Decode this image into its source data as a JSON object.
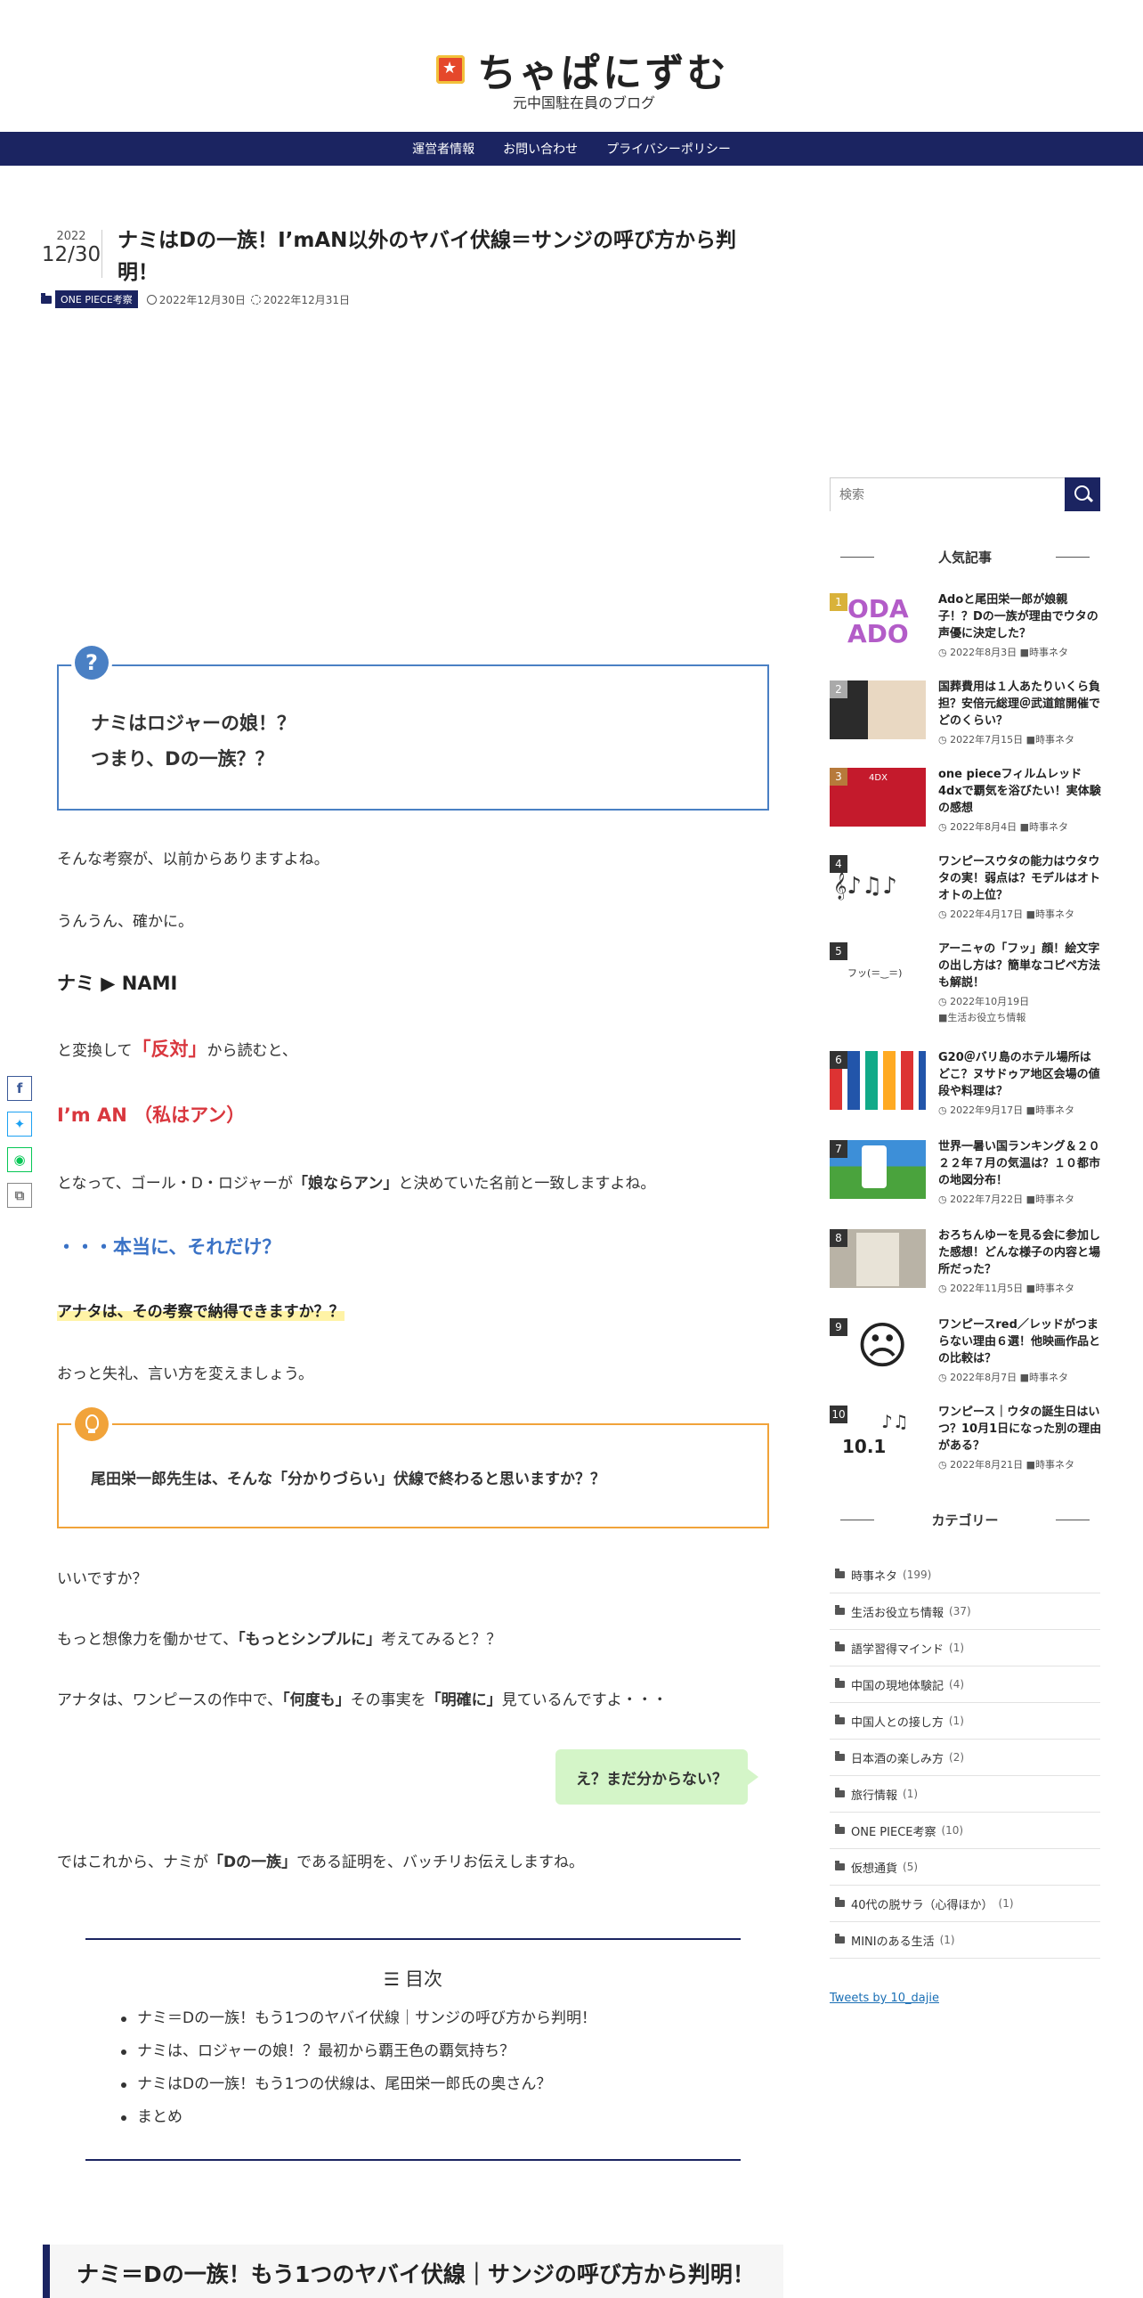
{
  "site": {
    "title": "ちゃぱにずむ",
    "subtitle": "元中国駐在員のブログ"
  },
  "nav": [
    "運営者情報",
    "お問い合わせ",
    "プライバシーポリシー"
  ],
  "post": {
    "year": "2022",
    "month_day": "12/30",
    "title": "ナミはDの一族！I’mAN以外のヤバイ伏線＝サンジの呼び方から判明！",
    "category": "ONE PIECE考察",
    "published": "2022年12月30日",
    "updated": "2022年12月31日"
  },
  "content": {
    "qbox_line1": "ナミはロジャーの娘！？",
    "qbox_line2": "つまり、Dの一族？？",
    "p1": "そんな考察が、以前からありますよね。",
    "p2": "うんうん、確かに。",
    "nami": "ナミ ▶ NAMI",
    "p3_a": "と変換して",
    "p3_red": "「反対」",
    "p3_b": "から読むと、",
    "im_an": "I’m AN （私はアン）",
    "p4_a": "となって、ゴール・D・ロジャーが",
    "p4_bold": "「娘ならアン」",
    "p4_b": "と決めていた名前と一致しますよね。",
    "blue": "・・・本当に、それだけ？",
    "marker": "アナタは、その考察で納得できますか？？",
    "p5": "おっと失礼、言い方を変えましょう。",
    "lbox": "尾田栄一郎先生は、そんな「分かりづらい」伏線で終わると思いますか？？",
    "p6": "いいですか？",
    "p7_a": "もっと想像力を働かせて、",
    "p7_bold": "「もっとシンプルに」",
    "p7_b": "考えてみると？？",
    "p8_a": "アナタは、ワンピースの作中で、",
    "p8_bold1": "「何度も」",
    "p8_mid": "その事実を",
    "p8_bold2": "「明確に」",
    "p8_b": "見ているんですよ・・・",
    "bubble": "え？まだ分からない？",
    "p9_a": "ではこれから、ナミが",
    "p9_bold": "「Dの一族」",
    "p9_b": "である証明を、バッチリお伝えしますね。"
  },
  "toc": {
    "title": "目次",
    "items": [
      "ナミ＝Dの一族！もう1つのヤバイ伏線｜サンジの呼び方から判明！",
      "ナミは、ロジャーの娘！？最初から覇王色の覇気持ち？",
      "ナミはDの一族！もう1つの伏線は、尾田栄一郎氏の奥さん？",
      "まとめ"
    ]
  },
  "h2": "ナミ＝Dの一族！もう1つのヤバイ伏線｜サンジの呼び方から判明！",
  "search": {
    "placeholder": "検索"
  },
  "popular": {
    "heading": "人気記事",
    "items": [
      {
        "rank": "1",
        "title": "Adoと尾田栄一郎が娘親子！？Dの一族が理由でウタの声優に決定した？",
        "date": "2022年8月3日",
        "cat": "時事ネタ",
        "thumb_text": "ODA ADO"
      },
      {
        "rank": "2",
        "title": "国葬費用は１人あたりいくら負担？安倍元総理＠武道館開催でどのくらい？",
        "date": "2022年7月15日",
        "cat": "時事ネタ",
        "thumb_text": ""
      },
      {
        "rank": "3",
        "title": "one pieceフィルムレッド4dxで覇気を浴びたい！実体験の感想",
        "date": "2022年8月4日",
        "cat": "時事ネタ",
        "thumb_text": "4DX"
      },
      {
        "rank": "4",
        "title": "ワンピースウタの能力はウタウタの実！弱点は？モデルはオトオトの上位？",
        "date": "2022年4月17日",
        "cat": "時事ネタ",
        "thumb_text": ""
      },
      {
        "rank": "5",
        "title": "アーニャの「フッ」顔！絵文字の出し方は？簡単なコピペ方法も解説！",
        "date": "2022年10月19日",
        "cat": "生活お役立ち情報",
        "thumb_text": "フッ(＝‿＝)"
      },
      {
        "rank": "6",
        "title": "G20＠バリ島のホテル場所はどこ？ヌサドゥア地区会場の値段や料理は？",
        "date": "2022年9月17日",
        "cat": "時事ネタ",
        "thumb_text": ""
      },
      {
        "rank": "7",
        "title": "世界一暑い国ランキング＆２０２２年７月の気温は？１０都市の地図分布！",
        "date": "2022年7月22日",
        "cat": "時事ネタ",
        "thumb_text": ""
      },
      {
        "rank": "8",
        "title": "おろちんゆーを見る会に参加した感想！どんな様子の内容と場所だった？",
        "date": "2022年11月5日",
        "cat": "時事ネタ",
        "thumb_text": ""
      },
      {
        "rank": "9",
        "title": "ワンピースred／レッドがつまらない理由６選！他映画作品との比較は？",
        "date": "2022年8月7日",
        "cat": "時事ネタ",
        "thumb_text": "☹"
      },
      {
        "rank": "10",
        "title": "ワンピース｜ウタの誕生日はいつ？10月1日になった別の理由がある？",
        "date": "2022年8月21日",
        "cat": "時事ネタ",
        "thumb_text": "10.1"
      }
    ]
  },
  "categories": {
    "heading": "カテゴリー",
    "items": [
      {
        "name": "時事ネタ",
        "count": "(199)"
      },
      {
        "name": "生活お役立ち情報",
        "count": "(37)"
      },
      {
        "name": "語学習得マインド",
        "count": "(1)"
      },
      {
        "name": "中国の現地体験記",
        "count": "(4)"
      },
      {
        "name": "中国人との接し方",
        "count": "(1)"
      },
      {
        "name": "日本酒の楽しみ方",
        "count": "(2)"
      },
      {
        "name": "旅行情報",
        "count": "(1)"
      },
      {
        "name": "ONE PIECE考察",
        "count": "(10)"
      },
      {
        "name": "仮想通貨",
        "count": "(5)"
      },
      {
        "name": "40代の脱サラ（心得ほか）",
        "count": "(1)"
      },
      {
        "name": "MINIのある生活",
        "count": "(1)"
      }
    ]
  },
  "tweets_link": "Tweets by 10_dajie",
  "share": [
    "f",
    "t",
    "line",
    "copy"
  ],
  "colors": {
    "brand": "#1b2461",
    "red": "#d9373e",
    "blue": "#3a72c6",
    "q_border": "#4a80c4",
    "tip_border": "#f1a33a",
    "bubble": "#d4f5c8",
    "marker": "#fff3a6"
  }
}
